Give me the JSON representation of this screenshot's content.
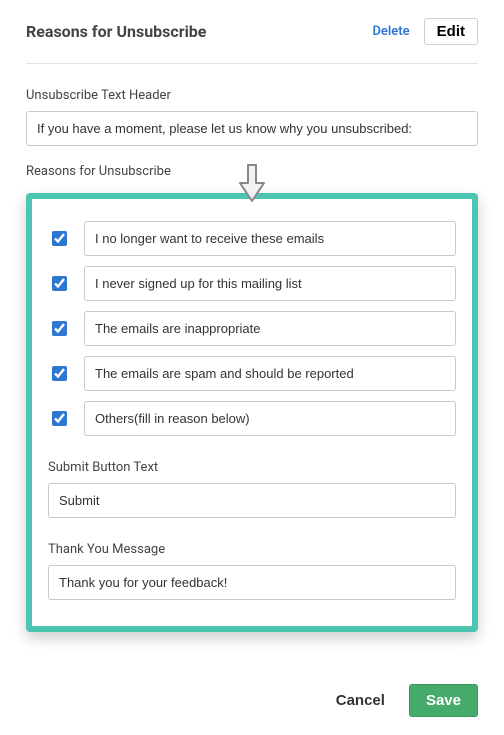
{
  "panel": {
    "title": "Reasons for Unsubscribe",
    "delete_label": "Delete",
    "edit_label": "Edit"
  },
  "header_label": "Unsubscribe Text Header",
  "header_value": "If you have a moment, please let us know why you unsubscribed:",
  "reasons_label": "Reasons for Unsubscribe",
  "reasons": [
    {
      "checked": true,
      "text": "I no longer want to receive these emails"
    },
    {
      "checked": true,
      "text": "I never signed up for this mailing list"
    },
    {
      "checked": true,
      "text": "The emails are inappropriate"
    },
    {
      "checked": true,
      "text": "The emails are spam and should be reported"
    },
    {
      "checked": true,
      "text": "Others(fill in reason below)"
    }
  ],
  "submit_label": "Submit Button Text",
  "submit_value": "Submit",
  "thankyou_label": "Thank You Message",
  "thankyou_value": "Thank you for your feedback!",
  "footer": {
    "cancel_label": "Cancel",
    "save_label": "Save"
  }
}
